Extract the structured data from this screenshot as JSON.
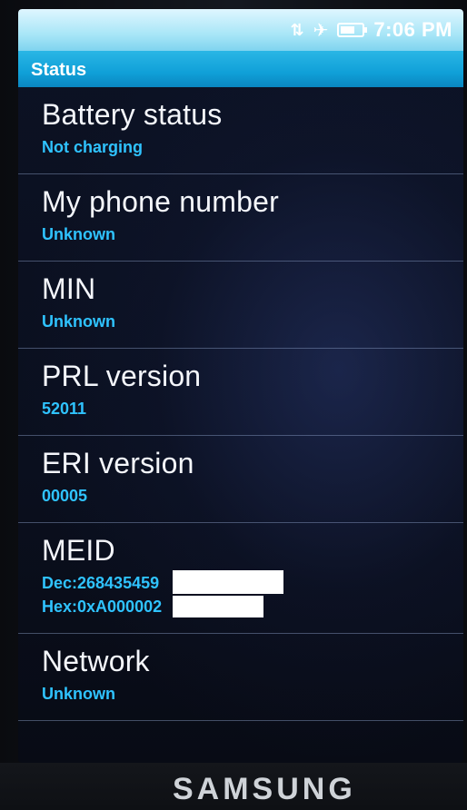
{
  "status_bar": {
    "time": "7:06 PM",
    "battery_level": 0.7
  },
  "title_bar": {
    "title": "Status"
  },
  "items": [
    {
      "label": "Battery status",
      "value": "Not charging"
    },
    {
      "label": "My phone number",
      "value": "Unknown"
    },
    {
      "label": "MIN",
      "value": "Unknown"
    },
    {
      "label": "PRL version",
      "value": "52011"
    },
    {
      "label": "ERI version",
      "value": "00005"
    },
    {
      "label": "MEID",
      "value": "Dec:268435459",
      "value2": "Hex:0xA000002"
    },
    {
      "label": "Network",
      "value": "Unknown"
    }
  ],
  "device": {
    "brand": "SAMSUNG"
  },
  "colors": {
    "accent_blue": "#2fc3ff",
    "title_bar": "#10a0d8"
  }
}
